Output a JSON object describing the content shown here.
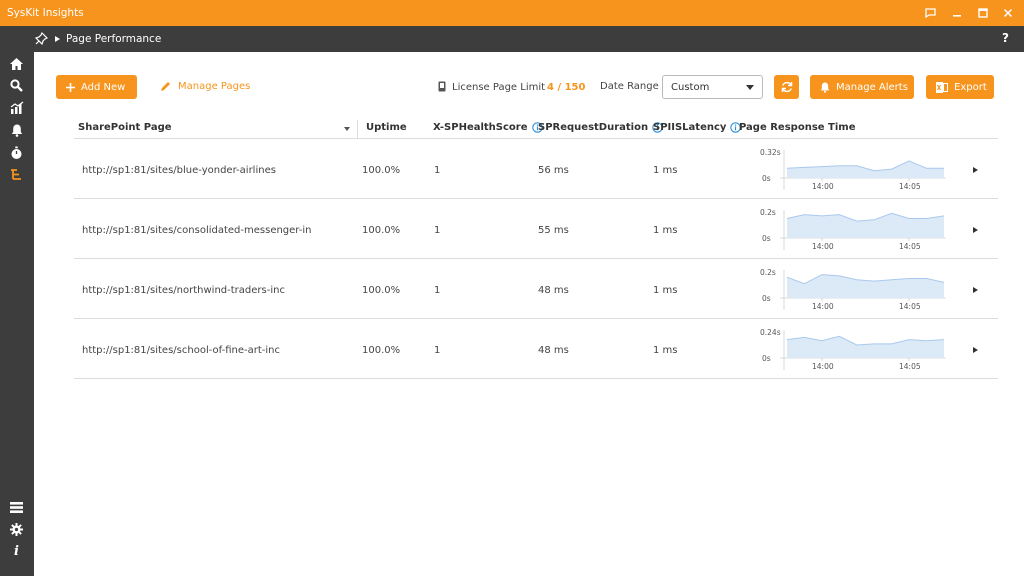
{
  "app": {
    "title": "SysKit Insights"
  },
  "breadcrumb": {
    "page": "Page Performance"
  },
  "toolbar": {
    "add_new": "Add New",
    "manage_pages": "Manage Pages",
    "license_label": "License Page Limit",
    "license_value": "4 / 150",
    "date_range_label": "Date Range",
    "date_range_value": "Custom",
    "manage_alerts": "Manage Alerts",
    "export": "Export"
  },
  "table": {
    "columns": [
      "SharePoint Page",
      "Uptime",
      "X-SPHealthScore",
      "SPRequestDuration",
      "SPIISLatency",
      "Page Response Time"
    ],
    "rows": [
      {
        "page": "http://sp1:81/sites/blue-yonder-airlines",
        "uptime": "100.0%",
        "health": "1",
        "duration": "56 ms",
        "latency": "1 ms",
        "chart": {
          "ymax_label": "0.32s",
          "ymin_label": "0s",
          "x_labels": [
            "14:00",
            "14:05"
          ],
          "ymax": 0.32,
          "values": [
            0.12,
            0.13,
            0.14,
            0.15,
            0.15,
            0.09,
            0.11,
            0.21,
            0.12,
            0.12
          ]
        }
      },
      {
        "page": "http://sp1:81/sites/consolidated-messenger-in",
        "uptime": "100.0%",
        "health": "1",
        "duration": "55 ms",
        "latency": "1 ms",
        "chart": {
          "ymax_label": "0.2s",
          "ymin_label": "0s",
          "x_labels": [
            "14:00",
            "14:05"
          ],
          "ymax": 0.2,
          "values": [
            0.15,
            0.18,
            0.17,
            0.18,
            0.13,
            0.14,
            0.19,
            0.15,
            0.15,
            0.17
          ]
        }
      },
      {
        "page": "http://sp1:81/sites/northwind-traders-inc",
        "uptime": "100.0%",
        "health": "1",
        "duration": "48 ms",
        "latency": "1 ms",
        "chart": {
          "ymax_label": "0.2s",
          "ymin_label": "0s",
          "x_labels": [
            "14:00",
            "14:05"
          ],
          "ymax": 0.2,
          "values": [
            0.16,
            0.11,
            0.18,
            0.17,
            0.14,
            0.13,
            0.14,
            0.15,
            0.15,
            0.12
          ]
        }
      },
      {
        "page": "http://sp1:81/sites/school-of-fine-art-inc",
        "uptime": "100.0%",
        "health": "1",
        "duration": "48 ms",
        "latency": "1 ms",
        "chart": {
          "ymax_label": "0.24s",
          "ymin_label": "0s",
          "x_labels": [
            "14:00",
            "14:05"
          ],
          "ymax": 0.24,
          "values": [
            0.17,
            0.19,
            0.16,
            0.2,
            0.12,
            0.13,
            0.13,
            0.17,
            0.16,
            0.17
          ]
        }
      }
    ]
  },
  "colors": {
    "accent": "#f7941d",
    "dark": "#3d3d3d",
    "chart_fill": "#dce9f7",
    "chart_line": "#a9c9ec",
    "info": "#2e8fd6"
  }
}
